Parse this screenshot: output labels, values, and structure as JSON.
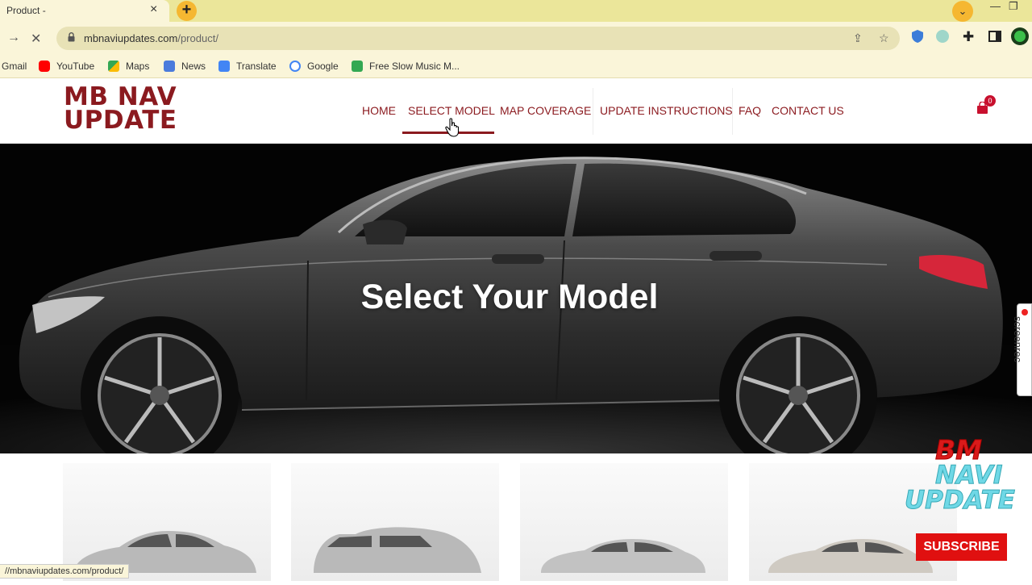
{
  "browser": {
    "tab_title": "Product -",
    "tab_close": "×",
    "new_tab": "+",
    "url_host": "mbnaviupdates.com",
    "url_path": "/product/",
    "status_url": "//mbnaviupdates.com/product/",
    "theme_color": "#ebe69a"
  },
  "bookmarks": [
    {
      "label": "Gmail",
      "icon": "gmail-icon"
    },
    {
      "label": "YouTube",
      "icon": "youtube-icon",
      "color": "#ff0000"
    },
    {
      "label": "Maps",
      "icon": "maps-icon"
    },
    {
      "label": "News",
      "icon": "news-icon"
    },
    {
      "label": "Translate",
      "icon": "translate-icon"
    },
    {
      "label": "Google",
      "icon": "google-icon"
    },
    {
      "label": "Free Slow Music M...",
      "icon": "px-icon"
    }
  ],
  "site": {
    "logo_line1": "MB NAV",
    "logo_line2": "UPDATE",
    "brand_color": "#8b1a1f",
    "menu": [
      "HOME",
      "SELECT MODEL",
      "MAP COVERAGE",
      "UPDATE INSTRUCTIONS",
      "FAQ",
      "CONTACT US"
    ],
    "active_menu": "SELECT MODEL",
    "cart_count": "0"
  },
  "hero": {
    "title": "Select Your Model"
  },
  "overlays": {
    "screenrec": "screenrec",
    "watermark_line1": "BM",
    "watermark_line2": "NAVI",
    "watermark_line3": "UPDATE",
    "subscribe": "SUBSCRIBE"
  }
}
